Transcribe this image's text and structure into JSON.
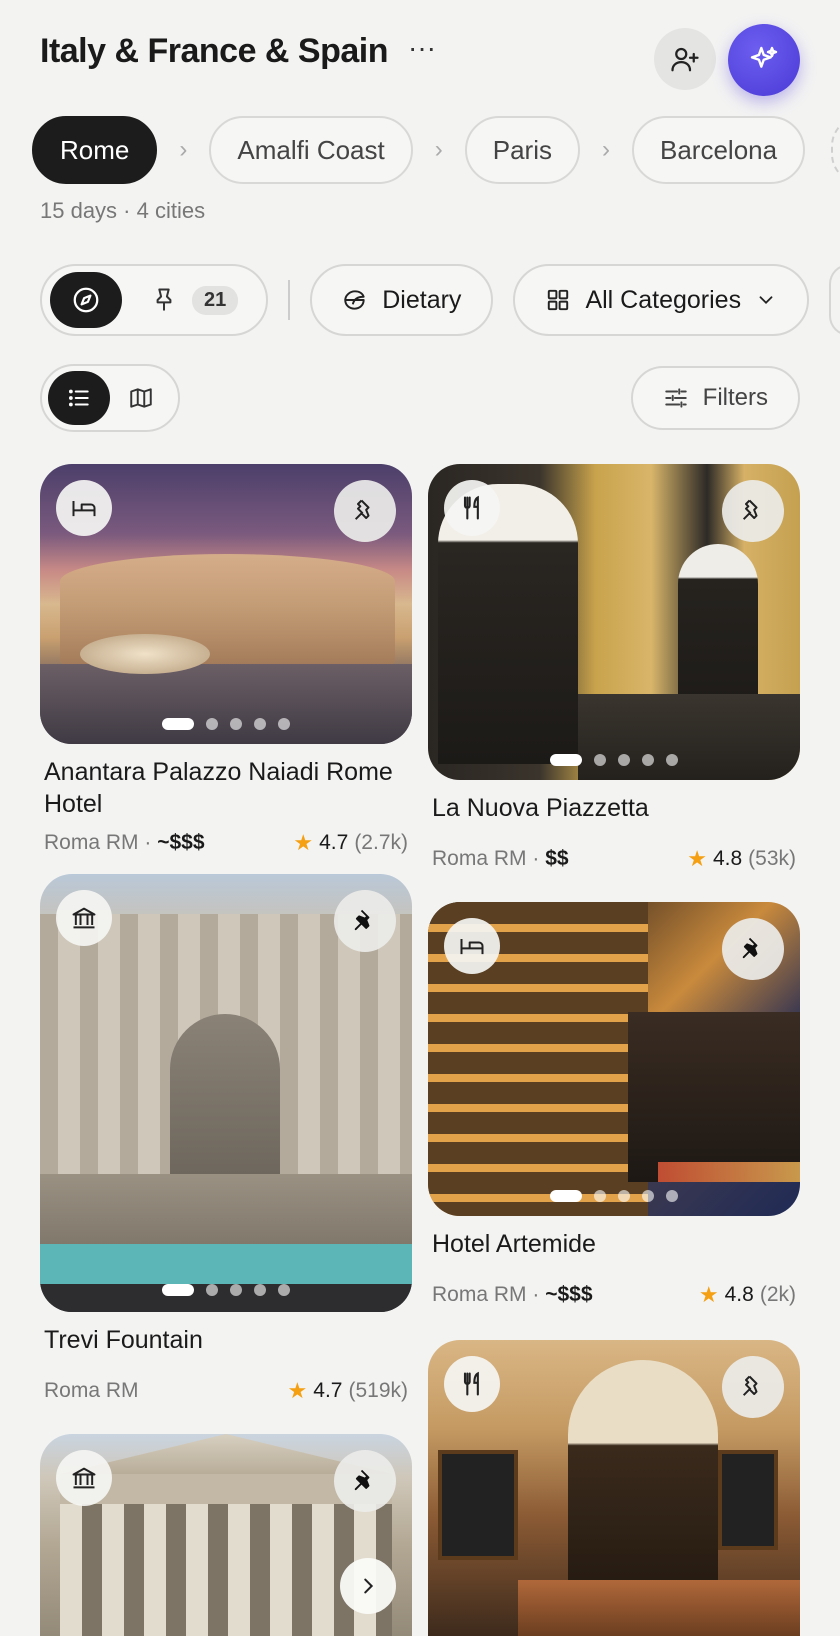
{
  "header": {
    "title": "Italy & France & Spain",
    "more_label": "···",
    "add_user_icon": "add-user-icon",
    "ai_icon": "sparkles-icon"
  },
  "cities": {
    "items": [
      {
        "label": "Rome",
        "active": true
      },
      {
        "label": "Amalfi Coast",
        "active": false
      },
      {
        "label": "Paris",
        "active": false
      },
      {
        "label": "Barcelona",
        "active": false
      }
    ],
    "separator_icon": "chevron-right-icon",
    "summary": "15 days · 4 cities"
  },
  "filters": {
    "explore_icon": "compass-icon",
    "pinned_icon": "pin-icon",
    "pinned_count": "21",
    "dietary_label": "Dietary",
    "dietary_icon": "dietary-icon",
    "categories_label": "All Categories",
    "categories_icon": "grid-icon",
    "filters_label": "Filters",
    "filters_icon": "sliders-icon"
  },
  "view": {
    "list_icon": "list-icon",
    "map_icon": "map-icon"
  },
  "cards": [
    {
      "name": "Anantara Palazzo Naiadi Rome Hotel",
      "location": "Roma RM",
      "price": "~$$$",
      "rating": "4.7",
      "reviews": "(2.7k)",
      "category_icon": "bed-icon",
      "pinned": false
    },
    {
      "name": "La Nuova Piazzetta",
      "location": "Roma RM",
      "price": "$$",
      "rating": "4.8",
      "reviews": "(53k)",
      "category_icon": "fork-knife-icon",
      "pinned": false
    },
    {
      "name": "Trevi Fountain",
      "location": "Roma RM",
      "price": "",
      "rating": "4.7",
      "reviews": "(519k)",
      "category_icon": "museum-icon",
      "pinned": true
    },
    {
      "name": "Hotel Artemide",
      "location": "Roma RM",
      "price": "~$$$",
      "rating": "4.8",
      "reviews": "(2k)",
      "category_icon": "bed-icon",
      "pinned": true
    },
    {
      "name": "",
      "location": "",
      "price": "",
      "rating": "",
      "reviews": "",
      "category_icon": "museum-icon",
      "pinned": true
    },
    {
      "name": "",
      "location": "",
      "price": "",
      "rating": "",
      "reviews": "",
      "category_icon": "fork-knife-icon",
      "pinned": false
    }
  ],
  "dot_separator": "·",
  "star_glyph": "★",
  "colors": {
    "accent": "#5a4ae3",
    "dark": "#1c1c1c",
    "star": "#f4a012",
    "background": "#f3f3f2"
  }
}
